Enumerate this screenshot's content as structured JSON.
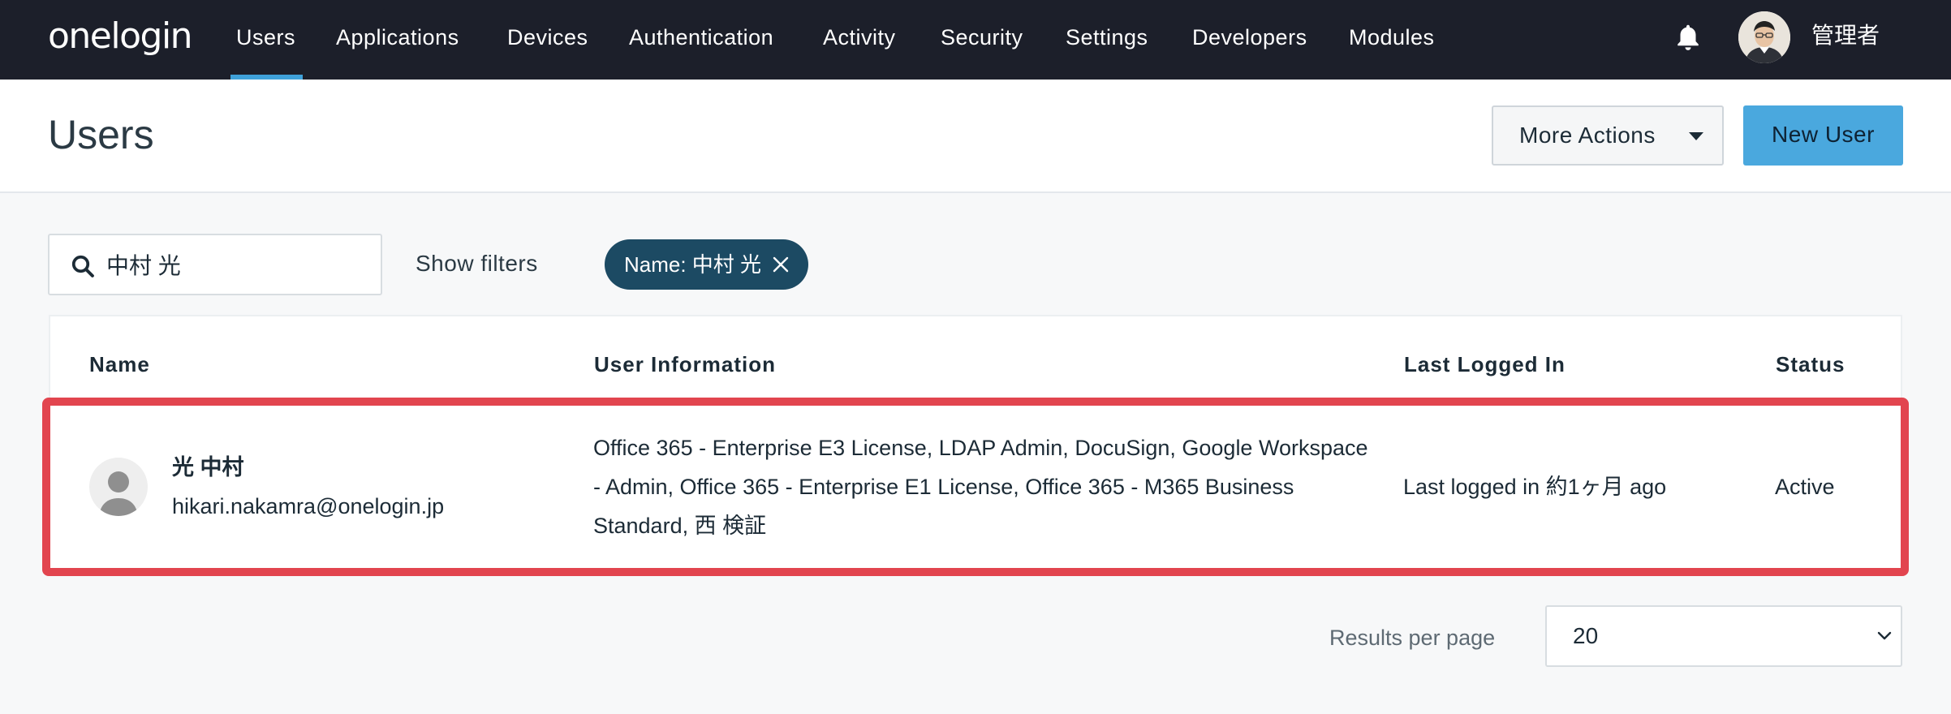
{
  "nav": {
    "logo": "onelogin",
    "items": [
      {
        "label": "Users",
        "active": true
      },
      {
        "label": "Applications",
        "active": false
      },
      {
        "label": "Devices",
        "active": false
      },
      {
        "label": "Authentication",
        "active": false
      },
      {
        "label": "Activity",
        "active": false
      },
      {
        "label": "Security",
        "active": false
      },
      {
        "label": "Settings",
        "active": false
      },
      {
        "label": "Developers",
        "active": false
      },
      {
        "label": "Modules",
        "active": false
      }
    ],
    "user_name": "管理者",
    "icons": {
      "notifications": "bell-icon",
      "profile": "avatar-photo"
    }
  },
  "header": {
    "title": "Users",
    "more_actions_label": "More Actions",
    "new_user_label": "New User"
  },
  "search": {
    "value": "中村 光",
    "icon": "search-icon",
    "show_filters_label": "Show filters",
    "chip_label": "Name: 中村 光",
    "chip_close_icon": "close-icon"
  },
  "table": {
    "headers": {
      "name": "Name",
      "user_information": "User Information",
      "last_logged_in": "Last Logged In",
      "status": "Status"
    },
    "rows": [
      {
        "full_name": "光 中村",
        "email": "hikari.nakamra@onelogin.jp",
        "user_information": "Office 365 - Enterprise E3 License, LDAP Admin, DocuSign, Google Workspace - Admin, Office 365 - Enterprise E1 License, Office 365 - M365 Business Standard, 西 検証",
        "last_logged_in": "Last logged in 約1ヶ月 ago",
        "status": "Active",
        "highlighted": true
      }
    ]
  },
  "pagination": {
    "results_per_page_label": "Results per page",
    "results_per_page_value": "20"
  },
  "colors": {
    "topbar": "#1c1f2a",
    "nav_active_underline": "#3fa1d9",
    "primary_button": "#4aa8de",
    "filter_chip": "#1c4a63",
    "row_highlight": "#e2454f"
  }
}
